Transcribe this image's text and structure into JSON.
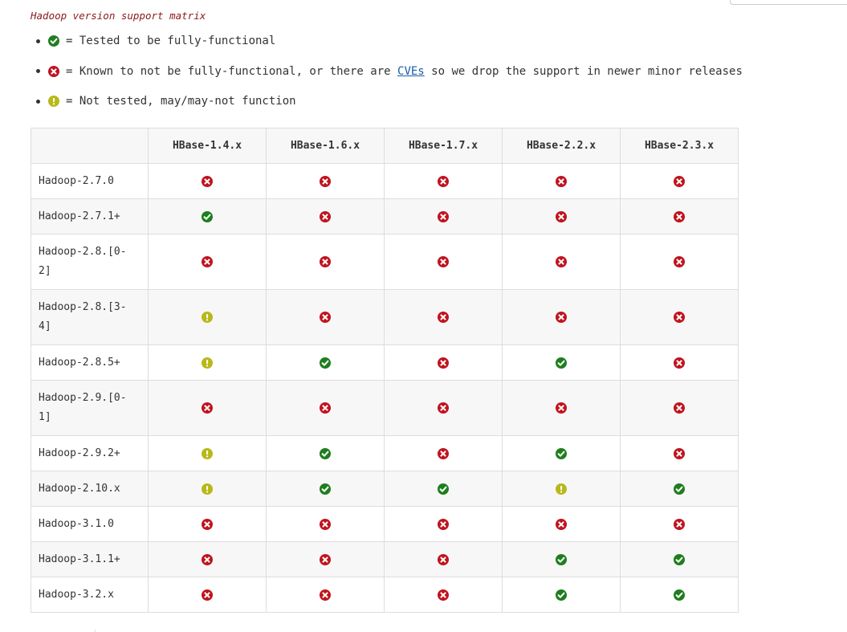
{
  "caption": "Hadoop version support matrix",
  "colors": {
    "supported": "#1e7e1e",
    "unsupported": "#c0141e",
    "untested": "#b8b81a",
    "link": "#1a5bab",
    "caption": "#8b1a1a"
  },
  "legend": [
    {
      "icon": "check-icon",
      "text": "= Tested to be fully-functional"
    },
    {
      "icon": "cross-icon",
      "text_before": "= Known to not be fully-functional, or there are ",
      "link": "CVEs",
      "text_after": " so we drop the support in newer minor releases"
    },
    {
      "icon": "exclamation-icon",
      "text": "= Not tested, may/may-not function"
    }
  ],
  "table": {
    "columns": [
      "HBase-1.4.x",
      "HBase-1.6.x",
      "HBase-1.7.x",
      "HBase-2.2.x",
      "HBase-2.3.x"
    ],
    "rows": [
      {
        "label": "Hadoop-2.7.0",
        "cells": [
          "x",
          "x",
          "x",
          "x",
          "x"
        ]
      },
      {
        "label": "Hadoop-2.7.1+",
        "cells": [
          "ok",
          "x",
          "x",
          "x",
          "x"
        ]
      },
      {
        "label": "Hadoop-2.8.[0-2]",
        "cells": [
          "x",
          "x",
          "x",
          "x",
          "x"
        ]
      },
      {
        "label": "Hadoop-2.8.[3-4]",
        "cells": [
          "warn",
          "x",
          "x",
          "x",
          "x"
        ]
      },
      {
        "label": "Hadoop-2.8.5+",
        "cells": [
          "warn",
          "ok",
          "x",
          "ok",
          "x"
        ]
      },
      {
        "label": "Hadoop-2.9.[0-1]",
        "cells": [
          "x",
          "x",
          "x",
          "x",
          "x"
        ]
      },
      {
        "label": "Hadoop-2.9.2+",
        "cells": [
          "warn",
          "ok",
          "x",
          "ok",
          "x"
        ]
      },
      {
        "label": "Hadoop-2.10.x",
        "cells": [
          "warn",
          "ok",
          "ok",
          "warn",
          "ok"
        ]
      },
      {
        "label": "Hadoop-3.1.0",
        "cells": [
          "x",
          "x",
          "x",
          "x",
          "x"
        ]
      },
      {
        "label": "Hadoop-3.1.1+",
        "cells": [
          "x",
          "x",
          "x",
          "ok",
          "ok"
        ]
      },
      {
        "label": "Hadoop-3.2.x",
        "cells": [
          "x",
          "x",
          "x",
          "ok",
          "ok"
        ]
      }
    ]
  }
}
